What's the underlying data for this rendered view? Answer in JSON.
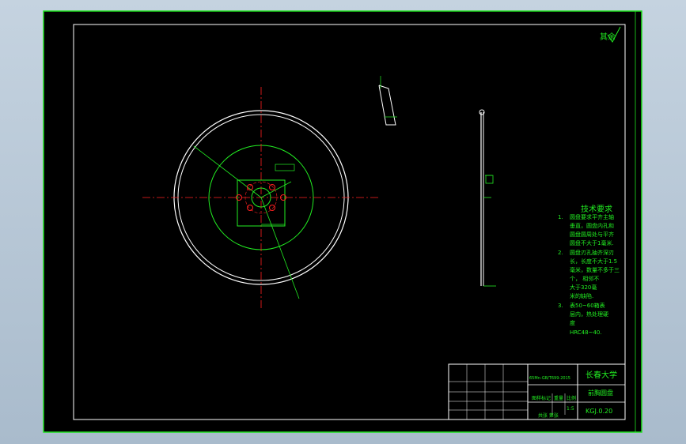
{
  "colors": {
    "background": "#000000",
    "frame": "#1ee01e",
    "geometry": "#ffffff",
    "centerline": "#ff2020",
    "dimension": "#22ee22",
    "viewport": "#b6c6d5"
  },
  "roughness_note": "其余",
  "tech_requirements": {
    "title": "技术要求",
    "items": [
      {
        "num": "1.",
        "lines": [
          "圆盘要求平齐主轴",
          "垂直，圆盘内孔和",
          "圆盘圆周处与平齐",
          "圆盘不大于1毫米."
        ]
      },
      {
        "num": "2.",
        "lines": [
          "圆盘刃孔抽齐深刃",
          "长，长度不大于1.5",
          "毫米，数量不多于三",
          "个，    相邻不",
          "大于320毫",
          "米的缺陷."
        ]
      },
      {
        "num": "3.",
        "lines": [
          "表50~60箱表",
          "层内，热处理硬",
          "度",
          "HRC48~40."
        ]
      }
    ]
  },
  "title_block": {
    "school": "长春大学",
    "part_name": "前胸圆盘",
    "drawing_no": "KGJ.0.20",
    "material": "65Mn-GB/T699-2015",
    "scale_value": "1:5",
    "headers": [
      "图样标记",
      "重量",
      "比例"
    ],
    "sheet": "共张 第张"
  }
}
